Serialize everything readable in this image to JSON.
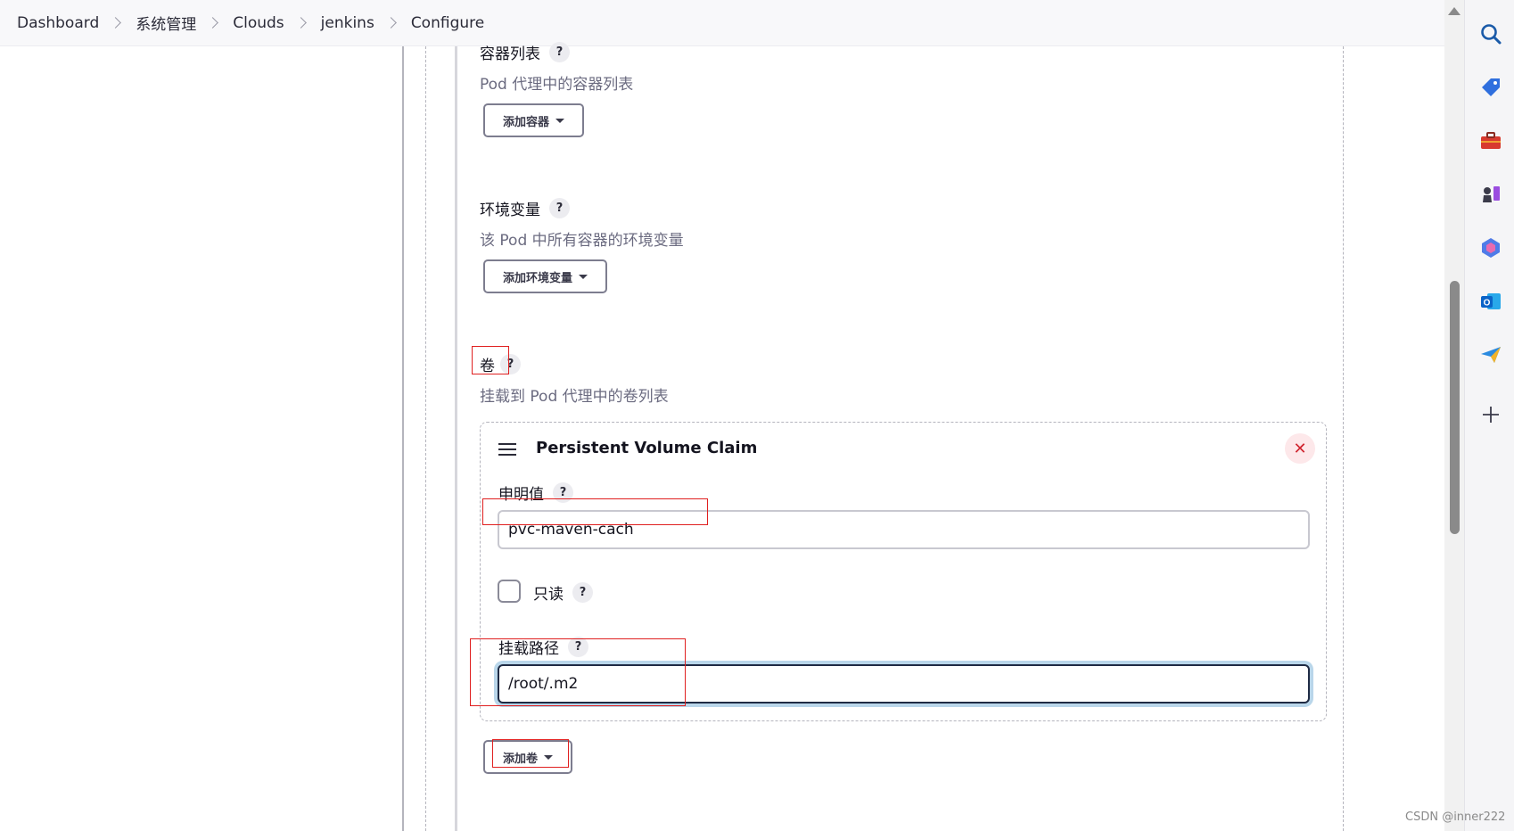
{
  "breadcrumb": [
    "Dashboard",
    "系统管理",
    "Clouds",
    "jenkins",
    "Configure"
  ],
  "containers": {
    "label": "容器列表",
    "help": "?",
    "description": "Pod 代理中的容器列表",
    "add_button": "添加容器"
  },
  "env": {
    "label": "环境变量",
    "help": "?",
    "description": "该 Pod 中所有容器的环境变量",
    "add_button": "添加环境变量"
  },
  "volumes": {
    "label": "卷",
    "help": "?",
    "description": "挂载到 Pod 代理中的卷列表",
    "add_button": "添加卷",
    "card": {
      "title": "Persistent Volume Claim",
      "close": "✕",
      "claim_label": "申明值",
      "claim_value": "pvc-maven-cach",
      "readonly_label": "只读",
      "readonly_checked": false,
      "mount_label": "挂载路径",
      "mount_value": "/root/.m2"
    }
  },
  "side_panel_icons": [
    "search-icon",
    "tag-icon",
    "toolbox-icon",
    "chess-icon",
    "copilot-icon",
    "outlook-icon",
    "send-icon",
    "plus-icon"
  ],
  "watermark": "CSDN @inner222",
  "colors": {
    "annotation_red": "#e02020",
    "focus_ring": "#b9d6ea"
  }
}
